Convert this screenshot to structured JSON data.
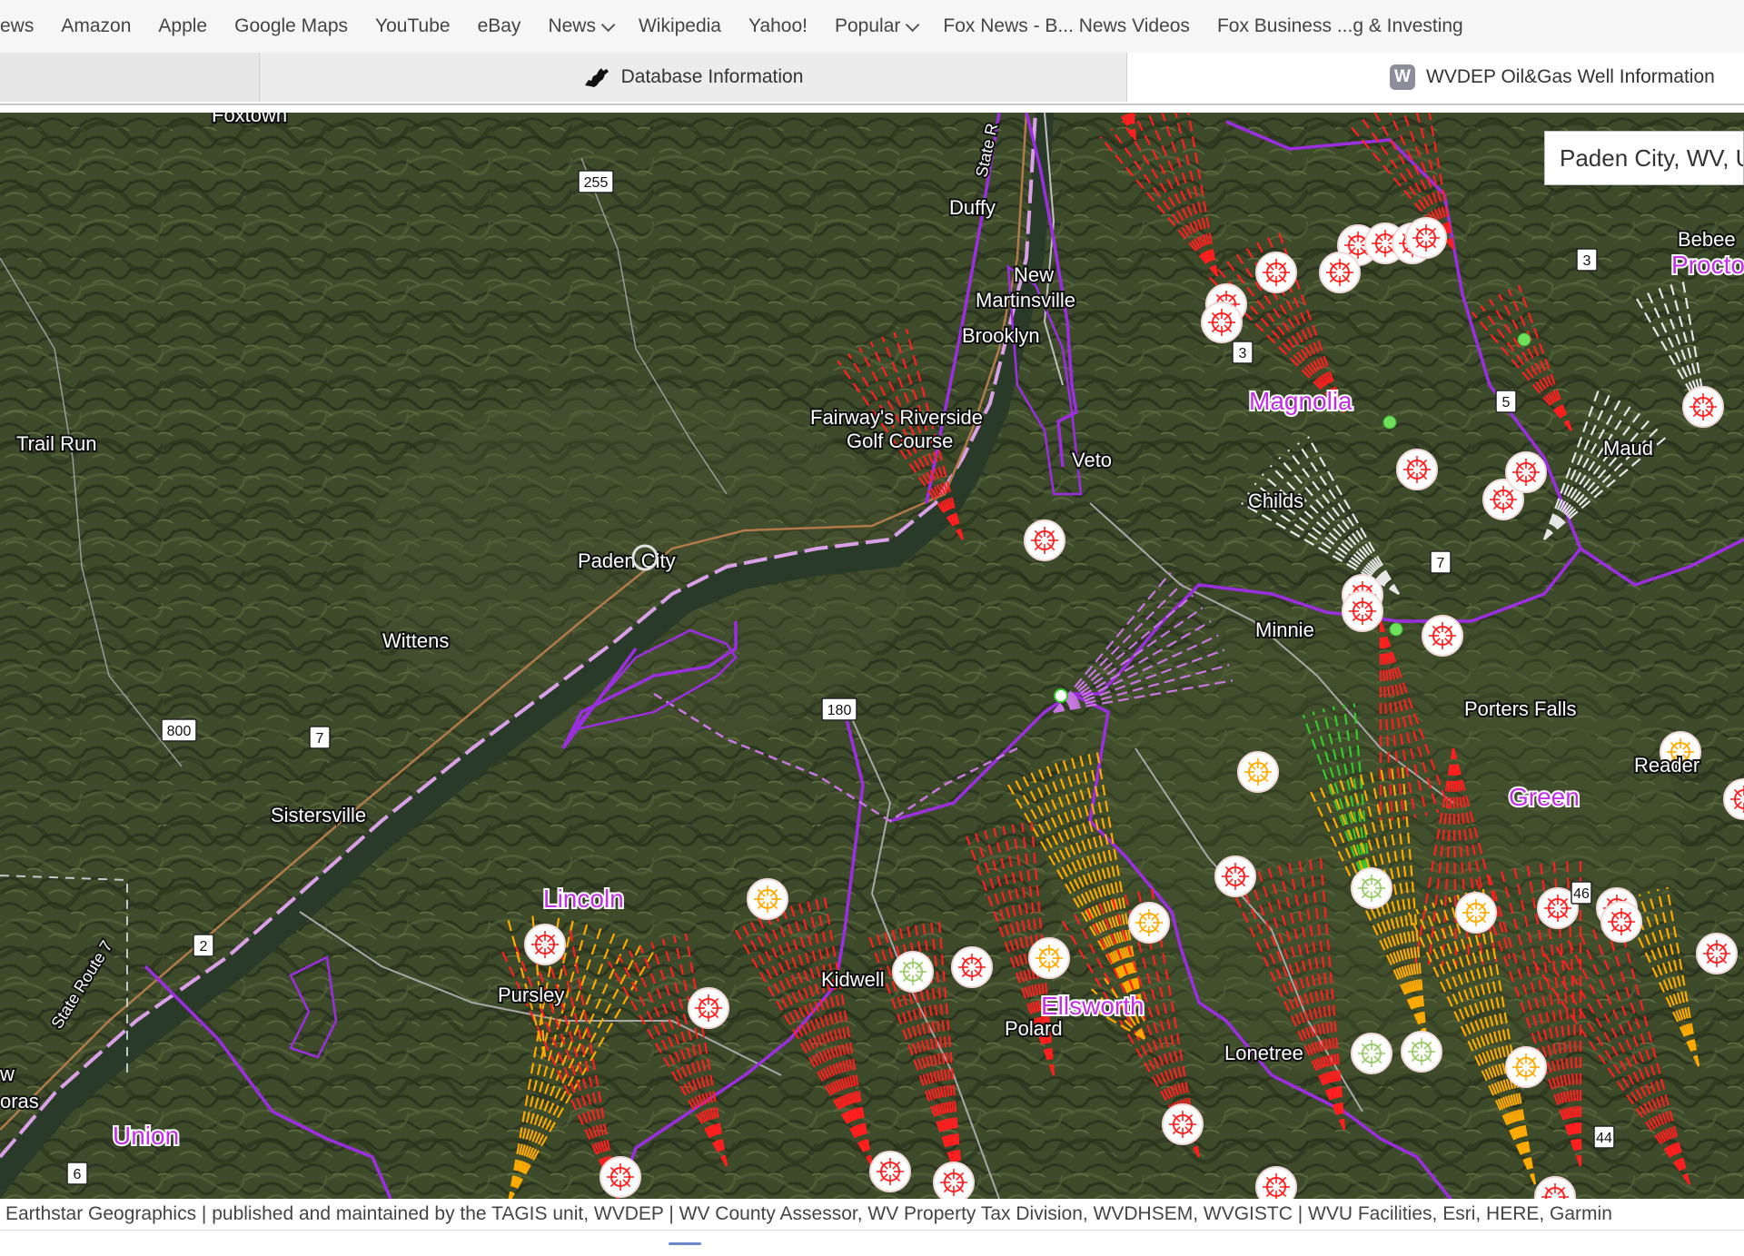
{
  "bookmarks": [
    {
      "label": "ews",
      "menu": false
    },
    {
      "label": "Amazon",
      "menu": false
    },
    {
      "label": "Apple",
      "menu": false
    },
    {
      "label": "Google Maps",
      "menu": false
    },
    {
      "label": "YouTube",
      "menu": false
    },
    {
      "label": "eBay",
      "menu": false
    },
    {
      "label": "News",
      "menu": true
    },
    {
      "label": "Wikipedia",
      "menu": false
    },
    {
      "label": "Yahoo!",
      "menu": false
    },
    {
      "label": "Popular",
      "menu": true
    },
    {
      "label": "Fox News - B... News Videos",
      "menu": false
    },
    {
      "label": "Fox Business ...g & Investing",
      "menu": false
    }
  ],
  "tabs": {
    "database": "Database Information",
    "wvdep": "WVDEP Oil&Gas Well Information",
    "wvdep_badge": "W"
  },
  "search": {
    "value": "Paden City, WV, U"
  },
  "map": {
    "places": [
      {
        "name": "Foxtown",
        "type": "town"
      },
      {
        "name": "Duffy",
        "type": "town"
      },
      {
        "name": "New",
        "type": "town"
      },
      {
        "name": "Martinsville",
        "type": "town"
      },
      {
        "name": "Brooklyn",
        "type": "town"
      },
      {
        "name": "Fairway's Riverside",
        "type": "poi"
      },
      {
        "name": "Golf Course",
        "type": "poi"
      },
      {
        "name": "Trail Run",
        "type": "town"
      },
      {
        "name": "Veto",
        "type": "town"
      },
      {
        "name": "Childs",
        "type": "town"
      },
      {
        "name": "Maud",
        "type": "town"
      },
      {
        "name": "Paden City",
        "type": "town"
      },
      {
        "name": "Wittens",
        "type": "town"
      },
      {
        "name": "Minnie",
        "type": "town"
      },
      {
        "name": "Porters Falls",
        "type": "town"
      },
      {
        "name": "Reader",
        "type": "town"
      },
      {
        "name": "Sistersville",
        "type": "town"
      },
      {
        "name": "Pursley",
        "type": "town"
      },
      {
        "name": "Kidwell",
        "type": "town"
      },
      {
        "name": "Polard",
        "type": "town"
      },
      {
        "name": "Lonetree",
        "type": "town"
      },
      {
        "name": "Bebee",
        "type": "town"
      },
      {
        "name": "w",
        "type": "town"
      },
      {
        "name": "oras",
        "type": "town"
      }
    ],
    "districts": [
      "Magnolia",
      "Green",
      "Lincoln",
      "Ellsworth",
      "Union",
      "Procto"
    ],
    "road_labels": [
      "State R",
      "State Route 7"
    ],
    "shields": [
      "255",
      "3",
      "3",
      "5",
      "7",
      "7",
      "180",
      "800",
      "2",
      "46",
      "44",
      "6"
    ],
    "colors": {
      "boundary": "#9b2fe0",
      "river_edge": "#d9a0e8",
      "well_red": "#ff1f1f",
      "well_orange": "#ffaa00",
      "well_green": "#35c92b",
      "well_white": "#e6e6e6",
      "well_violet": "#c878e0"
    }
  },
  "attribution": "Earthstar Geographics | published and maintained by the TAGIS unit, WVDEP | WV County Assessor, WV Property Tax Division, WVDHSEM, WVGISTC | WVU Facilities, Esri, HERE, Garmin"
}
